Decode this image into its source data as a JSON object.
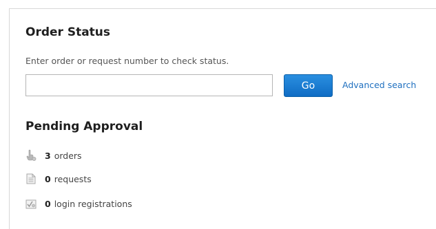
{
  "order_status": {
    "title": "Order Status",
    "hint": "Enter order or request number to check status.",
    "input_value": "",
    "input_placeholder": "",
    "go_label": "Go",
    "advanced_search_label": "Advanced search"
  },
  "pending_approval": {
    "title": "Pending Approval",
    "items": [
      {
        "icon": "hand-pointer-icon",
        "count": "3",
        "label": "orders"
      },
      {
        "icon": "document-list-icon",
        "count": "0",
        "label": "requests"
      },
      {
        "icon": "user-check-icon",
        "count": "0",
        "label": "login registrations"
      }
    ]
  },
  "colors": {
    "accent": "#1e6fbf",
    "button": "#0f6cc4",
    "text": "#333333",
    "border": "#d8d8d8"
  }
}
